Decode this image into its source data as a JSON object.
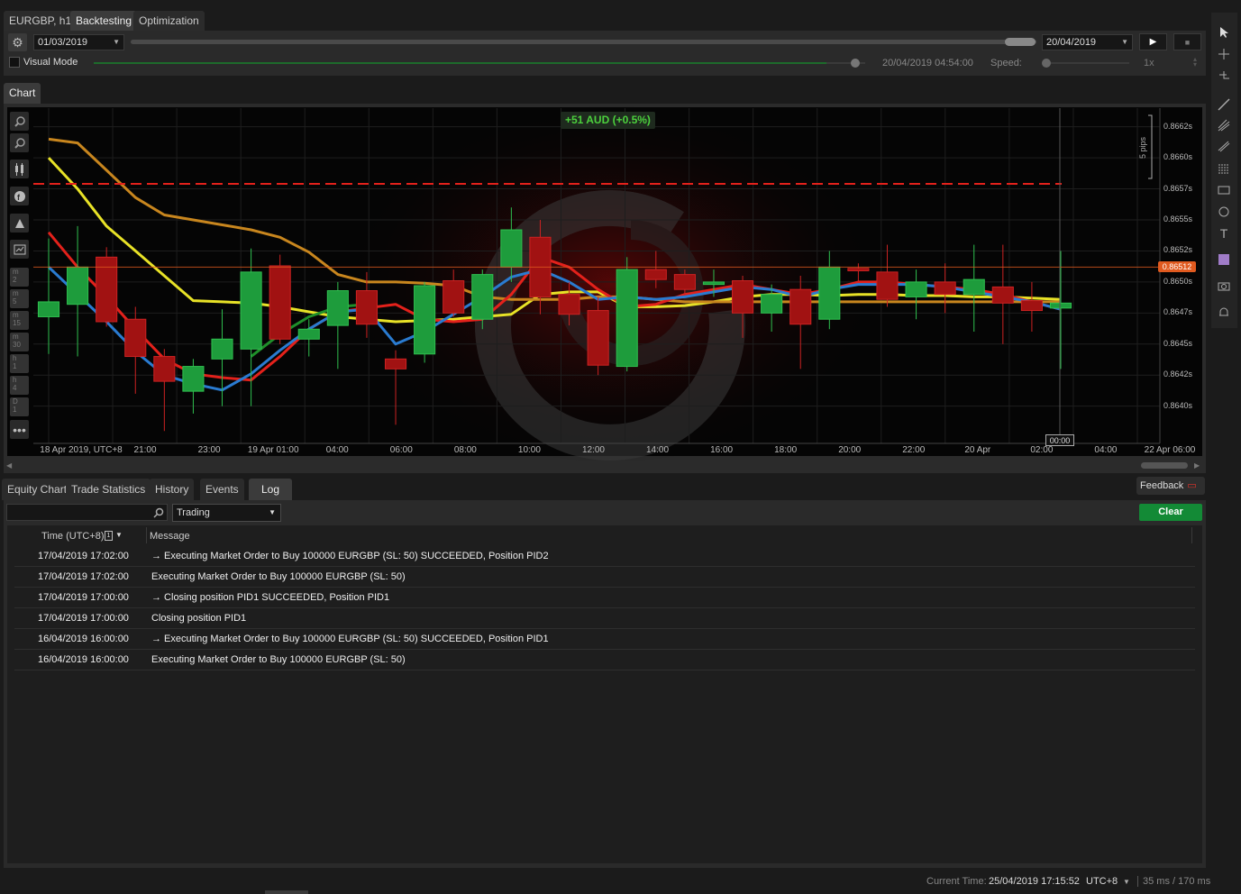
{
  "tabs": [
    {
      "label": "EURGBP, h1"
    },
    {
      "label": "Backtesting"
    },
    {
      "label": "Optimization"
    }
  ],
  "controls": {
    "start_date": "01/03/2019",
    "end_date": "20/04/2019",
    "visual_mode_label": "Visual Mode",
    "current_bar_time": "20/04/2019 04:54:00",
    "speed_label": "Speed:",
    "speed_value": "1x",
    "visual_progress_fraction": 0.95
  },
  "chart_tab": {
    "label": "Chart"
  },
  "chart_data": {
    "type": "candlestick",
    "symbol": "EURGBP",
    "timeframe": "h1",
    "pnl_badge": "+51 AUD (+0.5%)",
    "current_price_label": "0.86512",
    "current_price": 0.86512,
    "crosshair_time_label": "00:00",
    "scale_label": "5 pips",
    "y_ticks": [
      "0.8662s",
      "0.8660s",
      "0.8657s",
      "0.8655s",
      "0.8652s",
      "0.8650s",
      "0.8647s",
      "0.8645s",
      "0.8642s",
      "0.8640s"
    ],
    "y_tick_values": [
      0.86625,
      0.866,
      0.86575,
      0.8655,
      0.86525,
      0.865,
      0.86475,
      0.8645,
      0.86425,
      0.864
    ],
    "y_range": [
      0.8637,
      0.8664
    ],
    "x_ticks": [
      "18 Apr 2019, UTC+8",
      "21:00",
      "23:00",
      "19 Apr 01:00",
      "04:00",
      "06:00",
      "08:00",
      "10:00",
      "12:00",
      "14:00",
      "16:00",
      "18:00",
      "20:00",
      "22:00",
      "20 Apr",
      "02:00",
      "04:00",
      "22 Apr 06:00"
    ],
    "stop_loss_level": 0.86579,
    "candles": [
      {
        "o": 0.86472,
        "h": 0.86535,
        "l": 0.86442,
        "c": 0.86484
      },
      {
        "o": 0.86482,
        "h": 0.86545,
        "l": 0.8644,
        "c": 0.86512
      },
      {
        "o": 0.8652,
        "h": 0.86528,
        "l": 0.86464,
        "c": 0.86468
      },
      {
        "o": 0.8647,
        "h": 0.8648,
        "l": 0.8641,
        "c": 0.8644
      },
      {
        "o": 0.8644,
        "h": 0.86446,
        "l": 0.8638,
        "c": 0.8642
      },
      {
        "o": 0.86412,
        "h": 0.86438,
        "l": 0.86394,
        "c": 0.86432
      },
      {
        "o": 0.86438,
        "h": 0.86478,
        "l": 0.864,
        "c": 0.86454
      },
      {
        "o": 0.86446,
        "h": 0.86527,
        "l": 0.864,
        "c": 0.86508
      },
      {
        "o": 0.86513,
        "h": 0.86522,
        "l": 0.8645,
        "c": 0.86454
      },
      {
        "o": 0.86454,
        "h": 0.8647,
        "l": 0.8644,
        "c": 0.86462
      },
      {
        "o": 0.86465,
        "h": 0.865,
        "l": 0.8643,
        "c": 0.86493
      },
      {
        "o": 0.86493,
        "h": 0.86508,
        "l": 0.86455,
        "c": 0.86466
      },
      {
        "o": 0.86438,
        "h": 0.86445,
        "l": 0.86385,
        "c": 0.8643
      },
      {
        "o": 0.86442,
        "h": 0.865,
        "l": 0.86435,
        "c": 0.86497
      },
      {
        "o": 0.86501,
        "h": 0.8651,
        "l": 0.86472,
        "c": 0.86475
      },
      {
        "o": 0.8647,
        "h": 0.8651,
        "l": 0.86462,
        "c": 0.86506
      },
      {
        "o": 0.86512,
        "h": 0.8656,
        "l": 0.865,
        "c": 0.86542
      },
      {
        "o": 0.86536,
        "h": 0.8655,
        "l": 0.86474,
        "c": 0.86488
      },
      {
        "o": 0.8649,
        "h": 0.865,
        "l": 0.86465,
        "c": 0.86474
      },
      {
        "o": 0.86477,
        "h": 0.86488,
        "l": 0.86425,
        "c": 0.86433
      },
      {
        "o": 0.86432,
        "h": 0.8652,
        "l": 0.86428,
        "c": 0.8651
      },
      {
        "o": 0.8651,
        "h": 0.86525,
        "l": 0.86495,
        "c": 0.86502
      },
      {
        "o": 0.86506,
        "h": 0.8651,
        "l": 0.8649,
        "c": 0.86494
      },
      {
        "o": 0.86498,
        "h": 0.8651,
        "l": 0.86488,
        "c": 0.865
      },
      {
        "o": 0.86501,
        "h": 0.86505,
        "l": 0.86455,
        "c": 0.86475
      },
      {
        "o": 0.86475,
        "h": 0.86498,
        "l": 0.8646,
        "c": 0.8649
      },
      {
        "o": 0.86494,
        "h": 0.86505,
        "l": 0.8643,
        "c": 0.86466
      },
      {
        "o": 0.8647,
        "h": 0.86525,
        "l": 0.86462,
        "c": 0.86512
      },
      {
        "o": 0.86511,
        "h": 0.86515,
        "l": 0.865,
        "c": 0.86509
      },
      {
        "o": 0.86508,
        "h": 0.8653,
        "l": 0.8648,
        "c": 0.86486
      },
      {
        "o": 0.86488,
        "h": 0.8651,
        "l": 0.8647,
        "c": 0.865
      },
      {
        "o": 0.865,
        "h": 0.86515,
        "l": 0.86475,
        "c": 0.8649
      },
      {
        "o": 0.8649,
        "h": 0.8653,
        "l": 0.8646,
        "c": 0.86502
      },
      {
        "o": 0.86496,
        "h": 0.8653,
        "l": 0.8645,
        "c": 0.86483
      },
      {
        "o": 0.86485,
        "h": 0.865,
        "l": 0.8646,
        "c": 0.86477
      },
      {
        "o": 0.86479,
        "h": 0.86525,
        "l": 0.8643,
        "c": 0.86483
      }
    ],
    "series": [
      {
        "color": "#e8e227",
        "values": [
          0.866,
          0.86575,
          0.86545,
          0.86525,
          0.86505,
          0.86485,
          0.86484,
          0.86483,
          0.8648,
          0.86476,
          0.86472,
          0.8647,
          0.86468,
          0.86469,
          0.8647,
          0.86472,
          0.86474,
          0.8649,
          0.86492,
          0.86492,
          0.8648,
          0.8648,
          0.86481,
          0.86484,
          0.86488,
          0.8649,
          0.8649,
          0.86489,
          0.8649,
          0.8649,
          0.86489,
          0.86489,
          0.86488,
          0.86488,
          0.86487,
          0.86486
        ]
      },
      {
        "color": "#c8861e",
        "values": [
          0.86615,
          0.86612,
          0.8659,
          0.86568,
          0.86554,
          0.8655,
          0.86546,
          0.86542,
          0.86536,
          0.86524,
          0.86506,
          0.865,
          0.865,
          0.86499,
          0.86497,
          0.86488,
          0.86486,
          0.86486,
          0.86486,
          0.86488,
          0.86488,
          0.86486,
          0.86484,
          0.86484,
          0.86484,
          0.86484,
          0.86484,
          0.86484,
          0.86484,
          0.86484,
          0.86484,
          0.86484,
          0.86484,
          0.86484,
          0.86484,
          0.86484
        ]
      },
      {
        "color": "#e3211b",
        "values": [
          0.8654,
          0.86512,
          0.86488,
          0.86462,
          0.86438,
          0.86426,
          0.86423,
          0.86421,
          0.8644,
          0.86462,
          0.86476,
          0.86479,
          0.86482,
          0.8647,
          0.86468,
          0.8647,
          0.8649,
          0.8652,
          0.86512,
          0.86494,
          0.8648,
          0.86482,
          0.8649,
          0.86494,
          0.86498,
          0.86494,
          0.8649,
          0.86494,
          0.865,
          0.865,
          0.86498,
          0.86496,
          0.86494,
          0.8649,
          0.86484,
          0.86478
        ]
      },
      {
        "color": "#2a7bd0",
        "values": [
          0.86512,
          0.8649,
          0.86468,
          0.86444,
          0.86425,
          0.86418,
          0.86413,
          0.86426,
          0.86445,
          0.86462,
          0.86476,
          0.86478,
          0.8645,
          0.8646,
          0.86474,
          0.86488,
          0.86504,
          0.8651,
          0.865,
          0.86486,
          0.86488,
          0.86486,
          0.86488,
          0.86492,
          0.86496,
          0.86494,
          0.86488,
          0.86494,
          0.86498,
          0.86498,
          0.86498,
          0.86496,
          0.86492,
          0.86488,
          0.86484,
          0.86478
        ]
      },
      {
        "color": "#1f8f2a",
        "values": [
          null,
          null,
          null,
          null,
          null,
          null,
          null,
          0.8644,
          0.86458,
          0.86472,
          0.8648,
          0.86482
        ]
      }
    ]
  },
  "bottom_tabs": [
    {
      "label": "Equity Chart"
    },
    {
      "label": "Trade Statistics"
    },
    {
      "label": "History"
    },
    {
      "label": "Events"
    },
    {
      "label": "Log"
    }
  ],
  "feedback_label": "Feedback",
  "filter": {
    "search_value": "",
    "category": "Trading"
  },
  "clear_label": "Clear",
  "log": {
    "headers": {
      "time": "Time (UTC+8)",
      "message": "Message"
    },
    "rows": [
      {
        "time": "17/04/2019 17:02:00",
        "message": "→ Executing Market Order to Buy 100000 EURGBP (SL: 50) SUCCEEDED, Position PID2"
      },
      {
        "time": "17/04/2019 17:02:00",
        "message": "Executing Market Order to Buy 100000 EURGBP (SL: 50)"
      },
      {
        "time": "17/04/2019 17:00:00",
        "message": "→ Closing position PID1 SUCCEEDED, Position PID1"
      },
      {
        "time": "17/04/2019 17:00:00",
        "message": "Closing position PID1"
      },
      {
        "time": "16/04/2019 16:00:00",
        "message": "→ Executing Market Order to Buy 100000 EURGBP (SL: 50) SUCCEEDED, Position PID1"
      },
      {
        "time": "16/04/2019 16:00:00",
        "message": "Executing Market Order to Buy 100000 EURGBP (SL: 50)"
      }
    ]
  },
  "status": {
    "current_time_label": "Current Time:",
    "current_time": "25/04/2019 17:15:52",
    "timezone": "UTC+8",
    "latency": "35 ms / 170 ms"
  },
  "colors": {
    "bull": "#1e9c3c",
    "bear": "#a11212",
    "accent_green": "#138a36",
    "price_tag": "#e05a1f"
  }
}
